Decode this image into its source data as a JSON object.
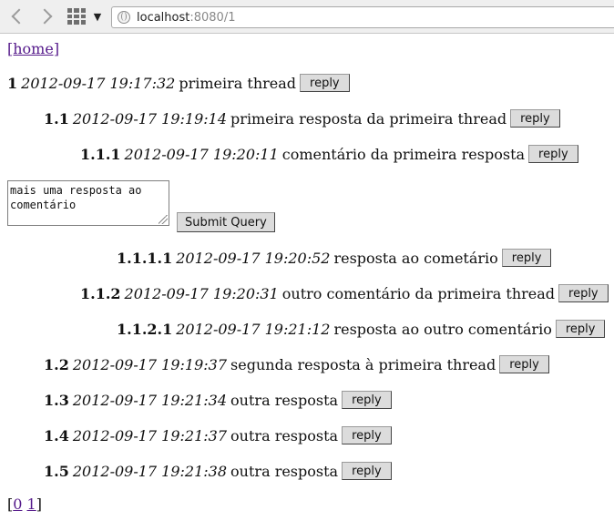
{
  "browser": {
    "url_host": "localhost",
    "url_rest": ":8080/1"
  },
  "page": {
    "home_label": "[home]",
    "reply_label": "reply",
    "submit_label": "Submit Query",
    "textarea_value": "mais uma resposta ao\ncomentário",
    "pager": {
      "open": "[",
      "page0": "0",
      "page1": "1",
      "close": "]"
    },
    "comments": [
      {
        "num": "1",
        "timestamp": "2012-09-17 19:17:32",
        "text": "primeira thread"
      },
      {
        "num": "1.1",
        "timestamp": "2012-09-17 19:19:14",
        "text": "primeira resposta da primeira thread"
      },
      {
        "num": "1.1.1",
        "timestamp": "2012-09-17 19:20:11",
        "text": "comentário da primeira resposta"
      },
      {
        "num": "1.1.1.1",
        "timestamp": "2012-09-17 19:20:52",
        "text": "resposta ao cometário"
      },
      {
        "num": "1.1.2",
        "timestamp": "2012-09-17 19:20:31",
        "text": "outro comentário da primeira thread"
      },
      {
        "num": "1.1.2.1",
        "timestamp": "2012-09-17 19:21:12",
        "text": "resposta ao outro comentário"
      },
      {
        "num": "1.2",
        "timestamp": "2012-09-17 19:19:37",
        "text": "segunda resposta à primeira thread"
      },
      {
        "num": "1.3",
        "timestamp": "2012-09-17 19:21:34",
        "text": "outra resposta"
      },
      {
        "num": "1.4",
        "timestamp": "2012-09-17 19:21:37",
        "text": "outra resposta"
      },
      {
        "num": "1.5",
        "timestamp": "2012-09-17 19:21:38",
        "text": "outra resposta"
      }
    ]
  }
}
